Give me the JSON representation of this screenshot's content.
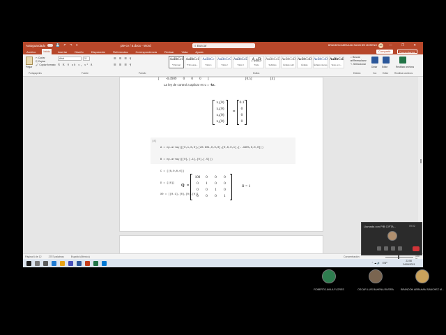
{
  "window": {
    "autosave_label": "Autoguardado",
    "quick_access": "💾 ↶ ↷ ▾",
    "doc_title": "pie-cv / 5.docx  -  Word",
    "search_placeholder": "Buscar",
    "user_name": "BRANDON ABRAHAM SANCHEZ MORENO",
    "user_initials": "SA",
    "controls": "— ❐ ✕"
  },
  "ribbon_tabs": [
    "Archivo",
    "Inicio",
    "Insertar",
    "Diseño",
    "Disposición",
    "Referencias",
    "Correspondencia",
    "Revisar",
    "Vista",
    "Ayuda"
  ],
  "ribbon_actions": {
    "share": "Compartir",
    "comments": "Comentarios"
  },
  "ribbon": {
    "paste": "Pegar",
    "cut": "Cortar",
    "copy": "Copiar",
    "format_painter": "Copiar formato",
    "font_name": "Arial",
    "font_size": "11",
    "format_buttons": "N K S ab x₂ x² A",
    "paragraph_buttons": "☰ ☰ ☰ ¶",
    "groups": {
      "clipboard": "Portapapeles",
      "font": "Fuente",
      "paragraph": "Párrafo",
      "styles": "Estilos",
      "editing": "Edición",
      "voice": "Voz",
      "editor": "Editor",
      "reuse": "Reutilizar archivos"
    },
    "styles": [
      {
        "preview": "AaBbCcI",
        "name": "¶ Normal"
      },
      {
        "preview": "AaBbCcI",
        "name": "¶ Sin espa..."
      },
      {
        "preview": "AaBbCc",
        "name": "Título 1"
      },
      {
        "preview": "AaBbCcC",
        "name": "Título 2"
      },
      {
        "preview": "AaBbCcD",
        "name": "Título 3"
      },
      {
        "preview": "AaB",
        "name": "Título"
      },
      {
        "preview": "AaBbCcD",
        "name": "Subtítulo"
      },
      {
        "preview": "AaBbCcDi",
        "name": "Énfasis sutil"
      },
      {
        "preview": "AaBbCcDi",
        "name": "Énfasis"
      },
      {
        "preview": "AaBbCcDi",
        "name": "Énfasis intenso"
      },
      {
        "preview": "AaBbCcDi",
        "name": "Texto en n..."
      }
    ],
    "find": "Buscar",
    "replace": "Reemplazar",
    "select": "Seleccionar",
    "dictate": "Dictar",
    "editor": "Editor",
    "reuse": "Reutilizar archivos"
  },
  "document": {
    "partial_row": "[ -0.4909   0   0   0 ]",
    "partial_vec_a": "[0.5]",
    "partial_vec_b": "[4]",
    "law_text": "La ley de control a aplicar es u = ",
    "law_bold": "-kx.",
    "x0_vector": [
      "x₁(0)",
      "x₂(0)",
      "x₃(0)",
      "x₄(0)"
    ],
    "x0_values": [
      "0.1",
      "0",
      "0",
      "0"
    ],
    "equals": "=",
    "code_index": "[8]",
    "code_lines": [
      "A = np.array([[0,1,0,0],[20.601,0,0,0],[0,0,0,1],[-.4905,0,0,0]])",
      "B = np.array([[0],[-1],[0],[.5]])",
      "C = [[0,0,0,0]]",
      "D = [[0]]",
      "X0 = [[0.1],[0],[0],[0]]"
    ],
    "q_label": "Q",
    "q_matrix": [
      "100",
      "0",
      "0",
      "0",
      "0",
      "1",
      "0",
      "0",
      "0",
      "0",
      "1",
      "0",
      "0",
      "0",
      "0",
      "1"
    ],
    "r_label": "R = 1"
  },
  "status": {
    "page": "Página 6 de 12",
    "words": "2757 palabras",
    "language": "Español (México)",
    "focus": "Concentración",
    "zoom": "100 %",
    "zoom_level": 0.45
  },
  "taskbar": {
    "clock": "22:50",
    "date": "24/05/2021",
    "lang": "ESP"
  },
  "call": {
    "title": "Llamada con PIB CIFTA...",
    "duration": "09:02"
  },
  "participants": [
    {
      "name": "ROBERTO AVILA FLORES",
      "color": "#2e7d4f"
    },
    {
      "name": "OSCAR LUIS BAHENA RIVERA",
      "color": "#7a6550"
    },
    {
      "name": "BRANDON ABRAHAM SANCHEZ M...",
      "color": "#c9a15b"
    }
  ],
  "colors": {
    "word_accent": "#b7472a",
    "taskbar": "#dde5ef",
    "end_call": "#d13438"
  }
}
